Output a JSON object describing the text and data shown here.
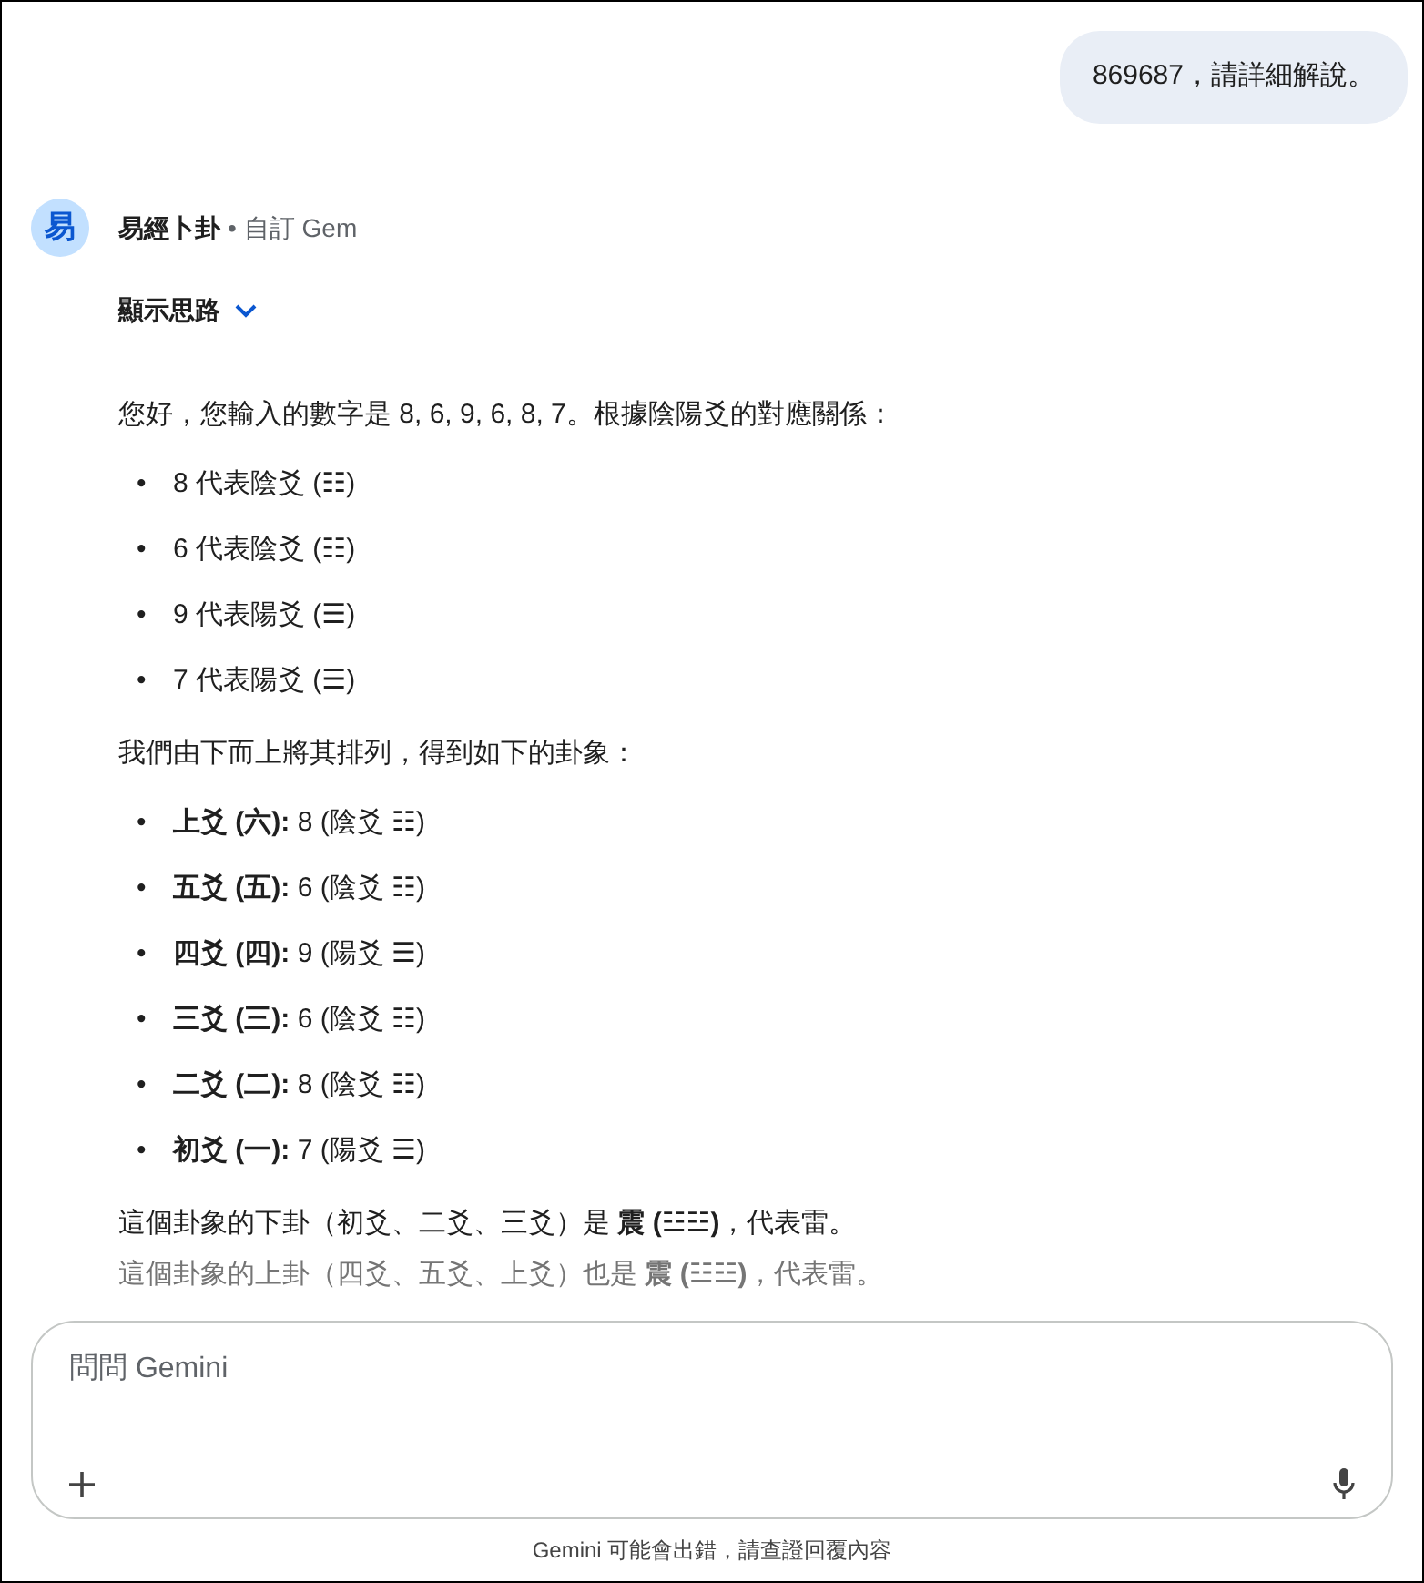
{
  "user_message": "869687，請詳細解說。",
  "response": {
    "avatar": "易",
    "gem_name": "易經卜卦",
    "separator": "•",
    "gem_tag": "自訂 Gem",
    "thoughts_toggle": {
      "label": "顯示思路",
      "expanded": false
    },
    "blocks": [
      {
        "kind": "paragraph",
        "text": "您好，您輸入的數字是 8, 6, 9, 6, 8, 7。根據陰陽爻的對應關係：",
        "faded": false
      },
      {
        "kind": "list",
        "bullet": "•",
        "items": [
          "8 代表陰爻 (☷)",
          "6 代表陰爻 (☷)",
          "9 代表陽爻 (☰)",
          "7 代表陽爻 (☰)"
        ]
      },
      {
        "kind": "paragraph",
        "text": "我們由下而上將其排列，得到如下的卦象：",
        "faded": false
      },
      {
        "kind": "list",
        "bullet": "•",
        "items": [
          "**上爻 (六):** 8 (陰爻 ☷)",
          "**五爻 (五):** 6 (陰爻 ☷)",
          "**四爻 (四):** 9 (陽爻 ☰)",
          "**三爻 (三):** 6 (陰爻 ☷)",
          "**二爻 (二):** 8 (陰爻 ☷)",
          "**初爻 (一):** 7 (陽爻 ☰)"
        ]
      },
      {
        "kind": "paragraph",
        "text": "這個卦象的下卦（初爻、二爻、三爻）是 **震 (☳☳)**，代表雷。",
        "faded": false
      },
      {
        "kind": "paragraph",
        "text": "這個卦象的上卦（四爻、五爻、上爻）也是 **震 (☳☳)**，代表雷。",
        "faded": true
      }
    ]
  },
  "composer": {
    "placeholder": "問問 Gemini"
  },
  "disclaimer": "Gemini 可能會出錯，請查證回覆內容"
}
